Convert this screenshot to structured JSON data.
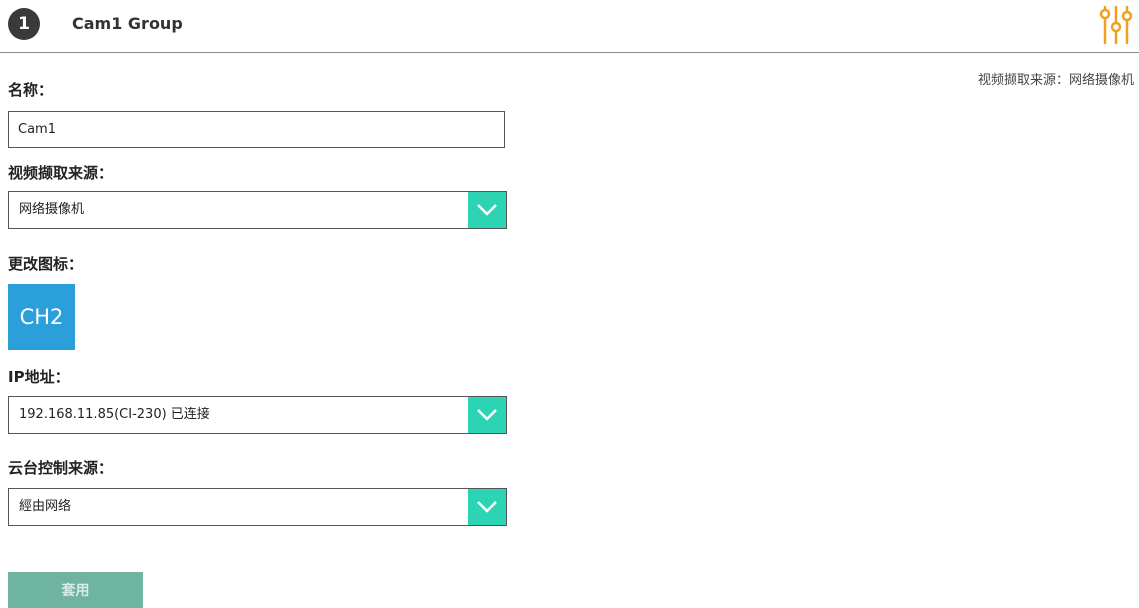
{
  "header": {
    "step_number": "1",
    "group_title": "Cam1 Group"
  },
  "source_info": "视频撷取来源：网络摄像机",
  "form": {
    "name_label": "名称：",
    "name_value": "Cam1",
    "video_source_label": "视频撷取来源：",
    "video_source_value": "网络摄像机",
    "change_icon_label": "更改图标：",
    "icon_text": "CH2",
    "ip_label": "IP地址：",
    "ip_value": "192.168.11.85(CI-230) 已连接",
    "ptz_label": "云台控制来源：",
    "ptz_value": "經由网络",
    "apply_label": "套用"
  },
  "icons": {
    "settings": "sliders-icon",
    "dropdown": "chevron-down-icon"
  },
  "colors": {
    "accent": "#2dd4b4",
    "icon_tile": "#2b9fd9",
    "apply_button": "#6fb4a0",
    "settings_icon": "#f0a020",
    "badge": "#3a3a3a"
  }
}
